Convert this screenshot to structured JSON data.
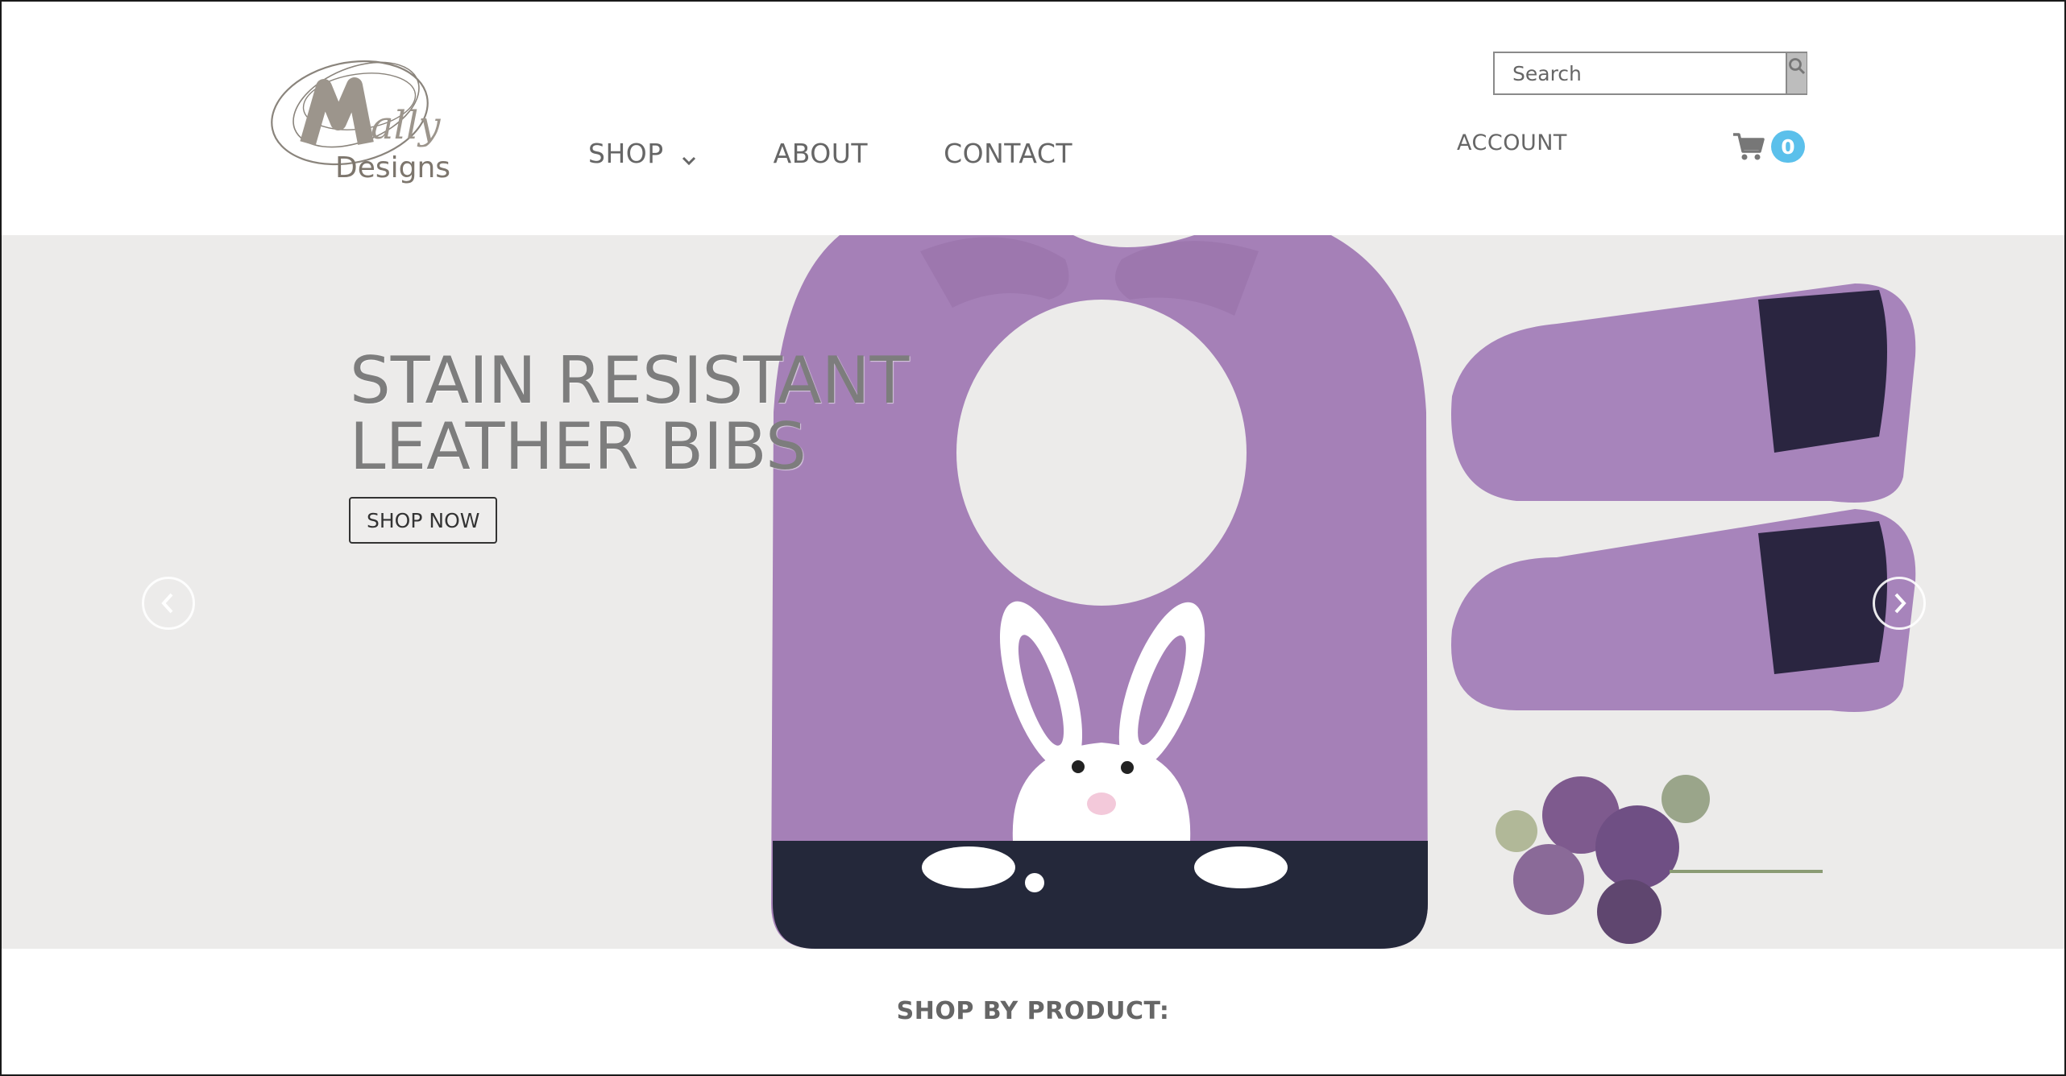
{
  "brand": {
    "logo_text_main": "Mally",
    "logo_text_sub": "Designs"
  },
  "nav": {
    "items": [
      {
        "label": "SHOP",
        "has_dropdown": true
      },
      {
        "label": "ABOUT"
      },
      {
        "label": "CONTACT"
      }
    ]
  },
  "search": {
    "placeholder": "Search",
    "icon": "search-icon"
  },
  "account": {
    "label": "ACCOUNT"
  },
  "cart": {
    "icon": "shopping-cart-icon",
    "count": "0",
    "badge_color": "#5bc0eb"
  },
  "hero": {
    "title_line1": "STAIN RESISTANT",
    "title_line2": "LEATHER BIBS",
    "cta_label": "SHOP NOW",
    "prev_icon": "chevron-left-icon",
    "next_icon": "chevron-right-icon",
    "bib_color": "#a27fb4",
    "bib_band_color": "#23273a"
  },
  "sections": {
    "shop_by_label": "SHOP BY PRODUCT:"
  }
}
